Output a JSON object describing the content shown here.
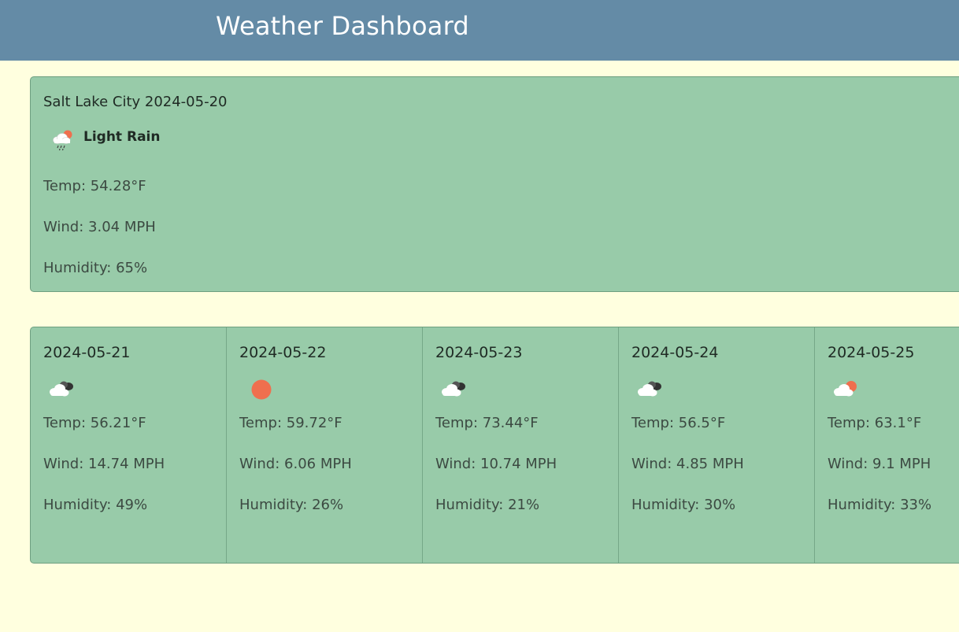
{
  "header": {
    "title": "Weather Dashboard"
  },
  "current": {
    "title": "Salt Lake City 2024-05-20",
    "condition": "Light Rain",
    "condition_icon": "light-rain-icon",
    "temp": "Temp: 54.28°F",
    "wind": "Wind: 3.04 MPH",
    "humidity": "Humidity: 65%"
  },
  "forecast": [
    {
      "date": "2024-05-21",
      "icon": "broken-clouds-icon",
      "temp": "Temp: 56.21°F",
      "wind": "Wind: 14.74 MPH",
      "humidity": "Humidity: 49%"
    },
    {
      "date": "2024-05-22",
      "icon": "clear-sky-icon",
      "temp": "Temp: 59.72°F",
      "wind": "Wind: 6.06 MPH",
      "humidity": "Humidity: 26%"
    },
    {
      "date": "2024-05-23",
      "icon": "broken-clouds-icon",
      "temp": "Temp: 73.44°F",
      "wind": "Wind: 10.74 MPH",
      "humidity": "Humidity: 21%"
    },
    {
      "date": "2024-05-24",
      "icon": "broken-clouds-icon",
      "temp": "Temp: 56.5°F",
      "wind": "Wind: 4.85 MPH",
      "humidity": "Humidity: 30%"
    },
    {
      "date": "2024-05-25",
      "icon": "few-clouds-icon",
      "temp": "Temp: 63.1°F",
      "wind": "Wind: 9.1 MPH",
      "humidity": "Humidity: 33%"
    }
  ],
  "colors": {
    "header_bg": "#648ba6",
    "page_bg": "#ffffdf",
    "card_bg": "#98cba9",
    "sun": "#ef6f4e"
  }
}
